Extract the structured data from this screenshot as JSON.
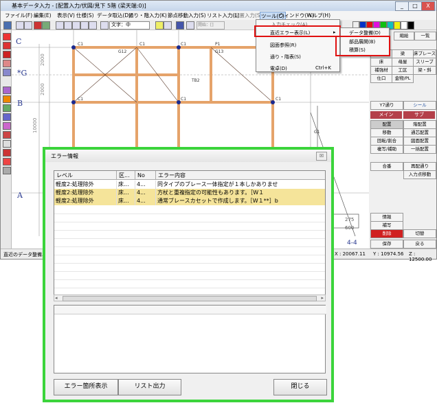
{
  "window": {
    "title": "基本データ入力 - [配置入力/伏図/見下 5階 (梁天端:0)]",
    "min": "_",
    "max": "□",
    "close": "X"
  },
  "menubar": [
    "ファイル(F)",
    "編集(E)",
    "表示(V)",
    "仕様(S)",
    "データ取込(D)",
    "通り・階入力(K)",
    "節点移動入力(S)",
    "リスト入力(L)",
    "配置入力(S)",
    "ツール(C)",
    "ウィンドウ(W)",
    "ヘルプ(H)"
  ],
  "toolbar": {
    "font_label": "文字：中",
    "dropdown": "開始：[]"
  },
  "axes": {
    "col_top": "C",
    "col_mid": "*G",
    "col_mid2": "B",
    "col_bot": "A",
    "dim_1": "2000",
    "dim_2": "2000",
    "dim_3": "10000",
    "dim_4": "275",
    "dim_5": "600",
    "dim_right": "4-4"
  },
  "plan_labels": [
    "C1",
    "C1",
    "C1",
    "C1",
    "C1",
    "C1",
    "C1",
    "G12",
    "G13",
    "TB2",
    "P1",
    "G1"
  ],
  "tools_menu": {
    "header": "入力チェック(A)",
    "items": [
      "直近エラー表示(L)",
      "図面参照(R)",
      "通り・階表(S)",
      "電卓(D)"
    ],
    "shortcut": "Ctrl+K"
  },
  "submenu": {
    "items": [
      "データ整備(D)",
      "部品展開(B)",
      "積算(S)"
    ]
  },
  "right_panel": {
    "top_buttons": [
      "縮絵",
      "一覧"
    ],
    "member_buttons": [
      "柱",
      "梁",
      "床ブレース",
      "床",
      "母屋",
      "スリーブ",
      "補強材",
      "工区",
      "梁・斜",
      "仕口",
      "金物/PL"
    ],
    "line_buttons": [
      "Y7通り",
      "シール"
    ],
    "main_tabs": [
      "メイン",
      "サブ"
    ],
    "main_buttons": [
      "配置",
      "移動",
      "回転/割合",
      "複写/補助",
      "",
      "",
      "合番"
    ],
    "sub_buttons": [
      "階配置",
      "通芯配置",
      "図面配置",
      "一括配置",
      "",
      "",
      "再配通り",
      "入力点移動"
    ],
    "bottom_buttons": [
      "情報",
      "補写",
      "削除",
      "切替",
      "保存",
      "戻る"
    ]
  },
  "status": {
    "left": "直近のデータ整備エラー",
    "x": "X : 20067.11",
    "y": "Y : 10974.56",
    "z": "Z : 12500.00"
  },
  "dialog": {
    "title": "エラー情報",
    "close": "☒",
    "columns": [
      "レベル",
      "区...",
      "No",
      "エラー内容"
    ],
    "rows": [
      {
        "level": "軽度2:処理除外",
        "cat": "床...",
        "no": "4...",
        "msg": "同タイプのブレース一体指定が１本しかありませ",
        "highlight": false
      },
      {
        "level": "軽度2:処理除外",
        "cat": "床...",
        "no": "4...",
        "msg": "方杖と重複指定の可能性もあります。［W１",
        "highlight": true
      },
      {
        "level": "軽度2:処理除外",
        "cat": "床...",
        "no": "4...",
        "msg": "通常ブレースカセットで作成します。［W１**］b",
        "highlight": true
      }
    ],
    "buttons": {
      "show": "エラー箇所表示",
      "export": "リスト出力",
      "close": "閉じる"
    }
  },
  "colors": {
    "highlight_row": "#f5e49a",
    "frame_green": "#3bd43b",
    "menu_red": "#e01010",
    "beam_orange": "#e5a36a"
  }
}
